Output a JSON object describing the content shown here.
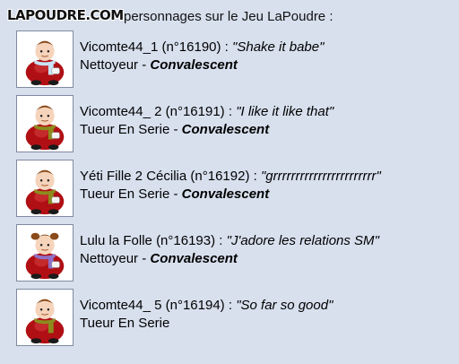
{
  "site": {
    "watermark": "LAPOUDRE.COM",
    "intro": "personnages sur le Jeu LaPoudre :"
  },
  "characters": [
    {
      "name": "Vicomte44_1",
      "number": "(n°16190)",
      "quote": "Shake it babe",
      "role": "Nettoyeur",
      "status": "Convalescent",
      "hair": "brown",
      "scarf": "#c8e4f6",
      "body": "#b00f14",
      "bandage": true
    },
    {
      "name": "Vicomte44_ 2",
      "number": "(n°16191)",
      "quote": "I like it like that",
      "role": "Tueur En Serie",
      "status": "Convalescent",
      "hair": "brown",
      "scarf": "#8c8c1e",
      "body": "#b00f14",
      "bandage": true
    },
    {
      "name": "Yéti Fille 2 Cécilia",
      "number": "(n°16192)",
      "quote": "grrrrrrrrrrrrrrrrrrrrrrr",
      "role": "Tueur En Serie",
      "status": "Convalescent",
      "hair": "brown",
      "scarf": "#8c8c1e",
      "body": "#b00f14",
      "bandage": true
    },
    {
      "name": "Lulu la Folle",
      "number": "(n°16193)",
      "quote": "J'adore les relations SM",
      "role": "Nettoyeur",
      "status": "Convalescent",
      "hair": "pigtails",
      "scarf": "#9070c8",
      "body": "#b00f14",
      "bandage": true
    },
    {
      "name": "Vicomte44_ 5",
      "number": "(n°16194)",
      "quote": "So far so good",
      "role": "Tueur En Serie",
      "status": "",
      "hair": "brown",
      "scarf": "#8c8c1e",
      "body": "#b00f14",
      "bandage": false
    }
  ],
  "separators": {
    "colon": " : ",
    "dash": " - "
  }
}
